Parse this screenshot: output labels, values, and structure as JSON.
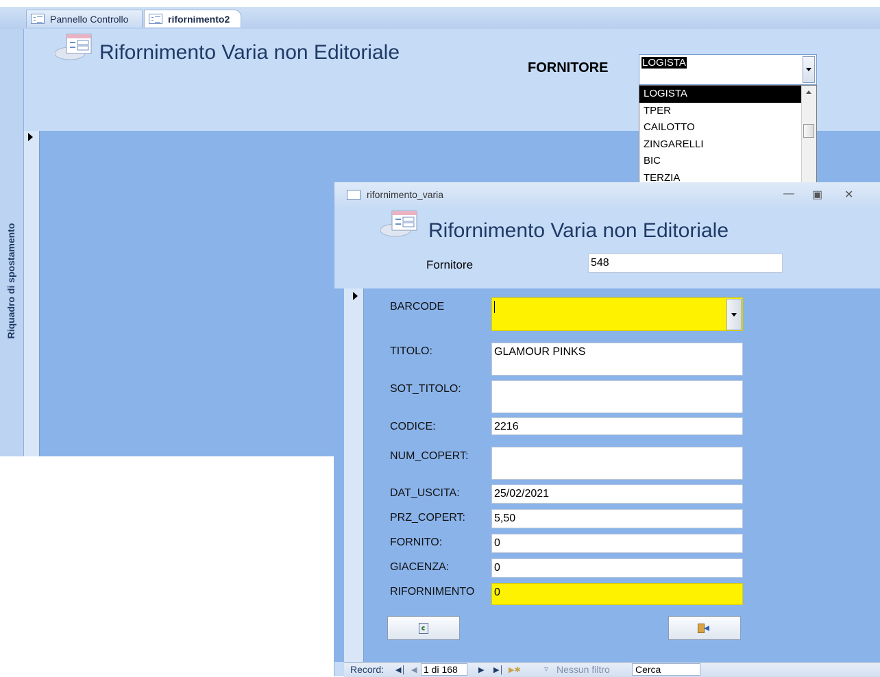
{
  "tabs": [
    {
      "label": "Pannello Controllo"
    },
    {
      "label": "rifornimento2"
    }
  ],
  "nav_pane": {
    "label": "Riquadro di spostamento"
  },
  "background_form": {
    "title": "Rifornimento Varia non Editoriale",
    "supplier_label": "FORNITORE",
    "supplier_combo": {
      "value": "LOGISTA",
      "options": [
        "LOGISTA",
        "TPER",
        "CAILOTTO",
        "ZINGARELLI",
        "BIC",
        "TERZIA"
      ],
      "selected_index": 0
    }
  },
  "popup": {
    "window_title": "rifornimento_varia",
    "heading": "Rifornimento Varia non Editoriale",
    "supplier_label": "Fornitore",
    "supplier_value": "548",
    "fields": [
      {
        "label": "BARCODE",
        "value": ""
      },
      {
        "label": "TITOLO:",
        "value": "GLAMOUR PINKS"
      },
      {
        "label": "SOT_TITOLO:",
        "value": ""
      },
      {
        "label": "CODICE:",
        "value": "2216"
      },
      {
        "label": "NUM_COPERT:",
        "value": ""
      },
      {
        "label": "DAT_USCITA:",
        "value": "25/02/2021"
      },
      {
        "label": "PRZ_COPERT:",
        "value": "5,50"
      },
      {
        "label": "FORNITO:",
        "value": "0"
      },
      {
        "label": "GIACENZA:",
        "value": "0"
      },
      {
        "label": "RIFORNIMENTO",
        "value": "0"
      }
    ],
    "highlight_color": "#fff200",
    "buttons": {
      "requery_icon": "requery-icon",
      "exit_icon": "exit-door-icon"
    },
    "record_nav": {
      "label": "Record:",
      "position": "1 di 168",
      "filter": "Nessun filtro",
      "search": "Cerca"
    }
  },
  "colors": {
    "header_bg": "#c5dbf6",
    "detail_bg": "#8ab3ea",
    "title_text": "#1f3a66"
  }
}
